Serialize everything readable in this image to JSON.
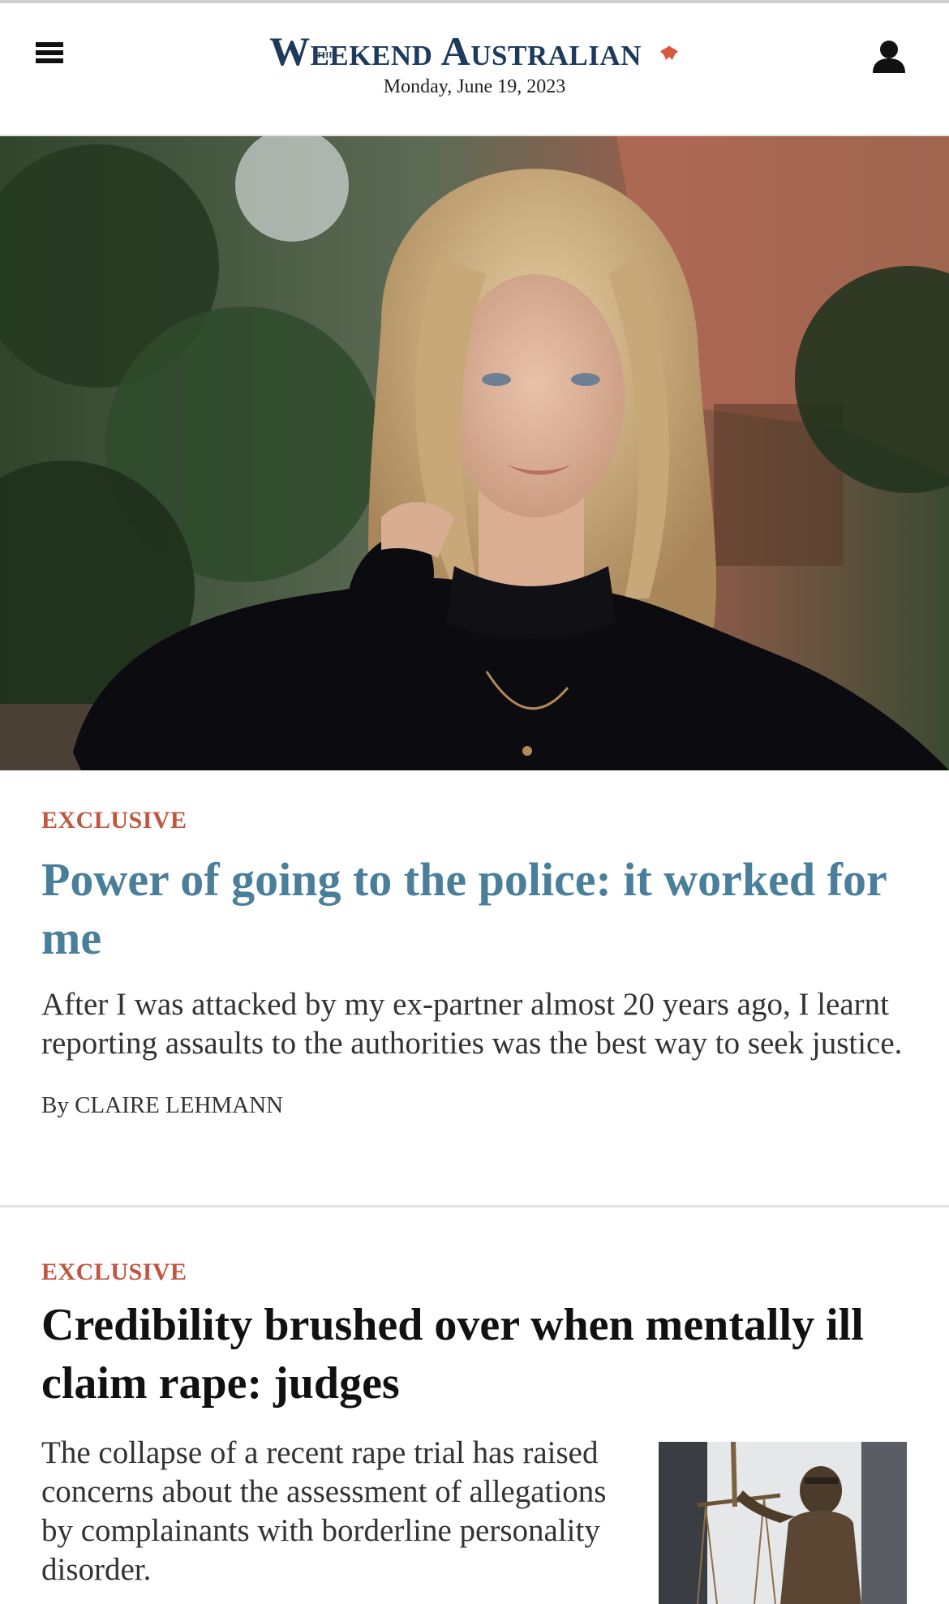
{
  "header": {
    "logo_small": "THE",
    "logo_text": "Weekend Australian",
    "date": "Monday, June 19, 2023"
  },
  "icons": {
    "menu": "hamburger-menu-icon",
    "account": "user-account-icon",
    "logo_mark": "flame-mark-icon"
  },
  "colors": {
    "brand": "#1d3a5c",
    "kicker": "#c0563f",
    "link_headline": "#4a7f9c"
  },
  "articles": [
    {
      "kicker": "EXCLUSIVE",
      "headline": "Power of going to the police: it worked for me",
      "standfirst": "After I was attacked by my ex-partner almost 20 years ago, I learnt reporting assaults to the authorities was the best way to seek justice.",
      "byline": "By CLAIRE LEHMANN"
    },
    {
      "kicker": "EXCLUSIVE",
      "headline": "Credibility brushed over when mentally ill claim rape: judges",
      "standfirst": "The collapse of a recent rape trial has raised concerns about the assessment of allegations by complainants with borderline personality disorder."
    }
  ]
}
